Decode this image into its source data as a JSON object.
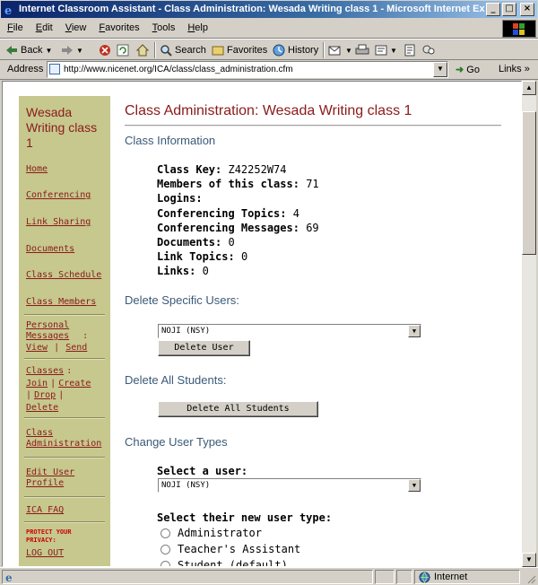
{
  "window": {
    "title": "Internet Classroom Assistant - Class Administration: Wesada Writing class 1 - Microsoft Internet Expl...",
    "minimize": "_",
    "maximize": "□",
    "close": "×"
  },
  "menu": [
    "File",
    "Edit",
    "View",
    "Favorites",
    "Tools",
    "Help"
  ],
  "toolbar": {
    "back": "Back",
    "search": "Search",
    "favorites": "Favorites",
    "history": "History"
  },
  "address": {
    "label": "Address",
    "url": "http://www.nicenet.org/ICA/class/class_administration.cfm",
    "go": "Go",
    "links": "Links »"
  },
  "sidebar": {
    "class_name": "Wesada Writing class 1",
    "home": "Home",
    "conferencing": "Conferencing",
    "link_sharing": "Link Sharing",
    "documents": "Documents",
    "class_schedule": "Class Schedule",
    "class_members": "Class Members",
    "personal_messages": "Personal Messages",
    "pm_sep": ":",
    "view": "View",
    "pipe": "|",
    "send": "Send",
    "classes": "Classes",
    "classes_sep": ":",
    "join": "Join",
    "create": "Create",
    "drop": "Drop",
    "delete": "Delete",
    "class_administration": "Class Administration",
    "edit_user_profile": "Edit User Profile",
    "ica_faq": "ICA FAQ",
    "protect_privacy": "PROTECT YOUR PRIVACY:",
    "log_out": "LOG OUT"
  },
  "main": {
    "title": "Class Administration: Wesada Writing class 1",
    "class_information": "Class Information",
    "info": [
      {
        "label": "Class Key:",
        "value": "Z42252W74"
      },
      {
        "label": "Members of this class:",
        "value": "71"
      },
      {
        "label": "Logins:",
        "value": ""
      },
      {
        "label": "Conferencing Topics:",
        "value": "4"
      },
      {
        "label": "Conferencing Messages:",
        "value": "69"
      },
      {
        "label": "Documents:",
        "value": "0"
      },
      {
        "label": "Link Topics:",
        "value": "0"
      },
      {
        "label": "Links:",
        "value": "0"
      }
    ],
    "delete_specific_users": "Delete Specific Users:",
    "delete_user_select": "NOJI (NSY)",
    "delete_user_button": "Delete User",
    "delete_all_students": "Delete All Students:",
    "delete_all_button": "Delete All Students",
    "change_user_types": "Change User Types",
    "select_user_label": "Select a user:",
    "select_user_value": "NOJI (NSY)",
    "select_type_label": "Select their new user type:",
    "types": [
      "Administrator",
      "Teacher's Assistant",
      "Student (default)"
    ]
  },
  "status": {
    "zone": "Internet"
  },
  "colors": {
    "sidebar_bg": "#c6c88e",
    "title_red": "#8b1a1a",
    "section_blue": "#3a5a78",
    "titlebar_blue": "#0a246a"
  }
}
